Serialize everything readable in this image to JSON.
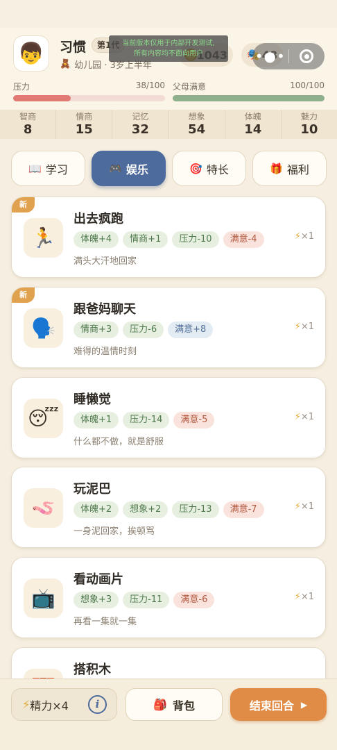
{
  "header": {
    "name": "习惯",
    "generation": "第1代",
    "stage_icon": "🧸",
    "stage": "幼儿园 · 3岁上半年",
    "avatar_emoji": "👦",
    "coins": "1043",
    "coin_icon": "gold-coin-icon",
    "fame": "48",
    "fame_icon": "🎭",
    "capsule_dots": "•●•",
    "dev_notice_line1": "当前版本仅用于内部开发测试,",
    "dev_notice_line2": "所有内容均不面向用户",
    "stress": {
      "label": "压力",
      "text": "38/100",
      "value": 38,
      "max": 100,
      "color": "#e07a72"
    },
    "satisfaction": {
      "label": "父母满意",
      "text": "100/100",
      "value": 100,
      "max": 100,
      "color": "#8fb08c"
    }
  },
  "stats": [
    {
      "name": "智商",
      "value": "8"
    },
    {
      "name": "情商",
      "value": "15"
    },
    {
      "name": "记忆",
      "value": "32"
    },
    {
      "name": "想象",
      "value": "54"
    },
    {
      "name": "体魄",
      "value": "14"
    },
    {
      "name": "魅力",
      "value": "10"
    }
  ],
  "tabs": [
    {
      "icon": "📖",
      "label": "学习",
      "active": false
    },
    {
      "icon": "🎮",
      "label": "娱乐",
      "active": true
    },
    {
      "icon": "🎯",
      "label": "特长",
      "active": false
    },
    {
      "icon": "🎁",
      "label": "福利",
      "active": false
    }
  ],
  "activities": [
    {
      "title": "出去疯跑",
      "icon": "🏃",
      "is_new": true,
      "new_label": "新",
      "effects": [
        {
          "text": "体魄+4",
          "kind": "pos"
        },
        {
          "text": "情商+1",
          "kind": "pos"
        },
        {
          "text": "压力-10",
          "kind": "pos"
        },
        {
          "text": "满意-4",
          "kind": "neg"
        }
      ],
      "desc": "满头大汗地回家",
      "cost": "×1"
    },
    {
      "title": "跟爸妈聊天",
      "icon": "🗣️",
      "is_new": true,
      "new_label": "新",
      "effects": [
        {
          "text": "情商+3",
          "kind": "pos"
        },
        {
          "text": "压力-6",
          "kind": "pos"
        },
        {
          "text": "满意+8",
          "kind": "blue"
        }
      ],
      "desc": "难得的温情时刻",
      "cost": "×1"
    },
    {
      "title": "睡懒觉",
      "icon": "😴",
      "is_new": false,
      "effects": [
        {
          "text": "体魄+1",
          "kind": "pos"
        },
        {
          "text": "压力-14",
          "kind": "pos"
        },
        {
          "text": "满意-5",
          "kind": "neg"
        }
      ],
      "desc": "什么都不做，就是舒服",
      "cost": "×1"
    },
    {
      "title": "玩泥巴",
      "icon": "🪱",
      "is_new": false,
      "effects": [
        {
          "text": "体魄+2",
          "kind": "pos"
        },
        {
          "text": "想象+2",
          "kind": "pos"
        },
        {
          "text": "压力-13",
          "kind": "pos"
        },
        {
          "text": "满意-7",
          "kind": "neg"
        }
      ],
      "desc": "一身泥回家，挨顿骂",
      "cost": "×1"
    },
    {
      "title": "看动画片",
      "icon": "📺",
      "is_new": false,
      "effects": [
        {
          "text": "想象+3",
          "kind": "pos"
        },
        {
          "text": "压力-11",
          "kind": "pos"
        },
        {
          "text": "满意-6",
          "kind": "neg"
        }
      ],
      "desc": "再看一集就一集",
      "cost": "×1"
    },
    {
      "title": "搭积木",
      "icon": "🧱",
      "is_new": false,
      "effects": [],
      "desc": "",
      "cost": ""
    }
  ],
  "bottom": {
    "energy_icon": "⚡",
    "energy_label": "精力×4",
    "info_label": "i",
    "bag_icon": "🎒",
    "bag_label": "背包",
    "end_label": "结束回合",
    "end_arrow": "▶"
  },
  "colors": {
    "accent_blue": "#4d6b9c",
    "end_orange": "#e08c46",
    "new_badge": "#e0a24f",
    "bolt": "#e0a830"
  }
}
